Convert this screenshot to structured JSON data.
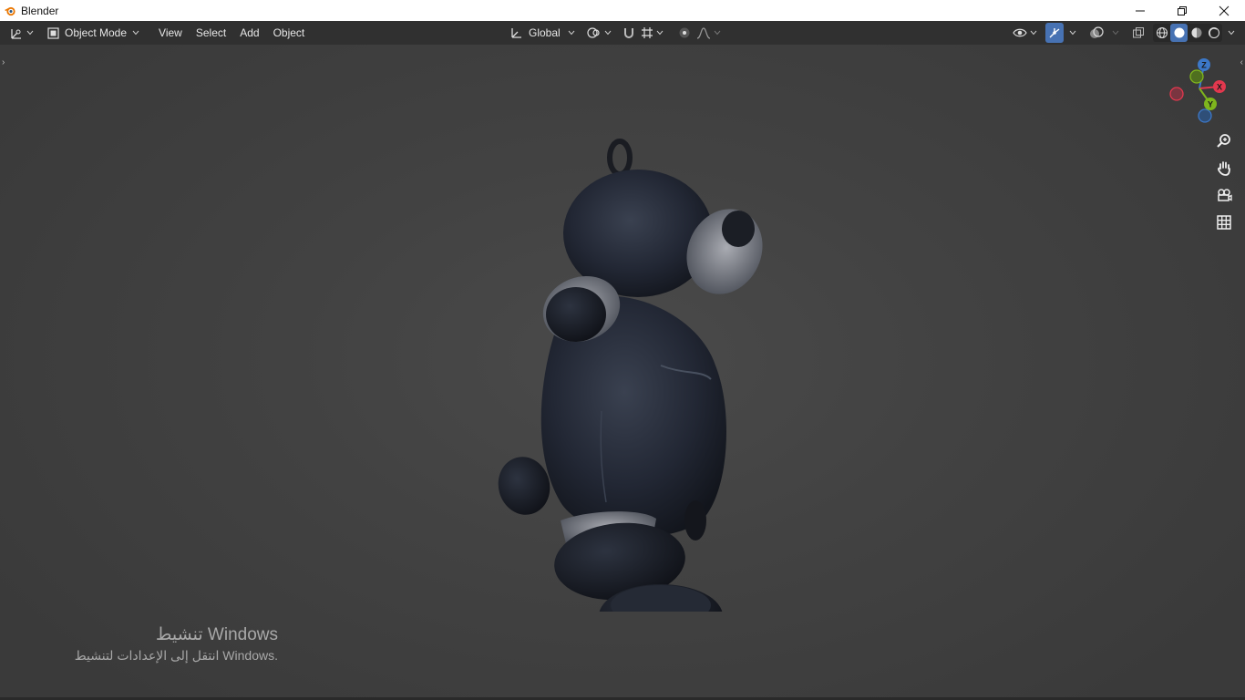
{
  "window": {
    "title": "Blender",
    "app_icon": "blender-logo-icon",
    "controls": [
      "minimize-icon",
      "restore-icon",
      "close-icon"
    ]
  },
  "header": {
    "editor_type_icon": "editor-type-3d-viewport-icon",
    "mode": "Object Mode",
    "menus": [
      "View",
      "Select",
      "Add",
      "Object"
    ],
    "transform_orientation": "Global",
    "pivot_icon": "pivot-point-icon",
    "snap_icon": "snap-magnet-icon",
    "snap_target_icon": "snap-increment-icon",
    "proportional_icon": "proportional-edit-icon",
    "falloff_icon": "falloff-curve-icon",
    "visibility_icon": "object-visibility-icon",
    "gizmo_toggle_icon": "gizmo-toggle-icon",
    "overlay_icon": "overlays-icon",
    "xray_icon": "xray-toggle-icon",
    "shading_modes": [
      "wireframe-shading-icon",
      "solid-shading-icon",
      "material-preview-icon",
      "rendered-shading-icon"
    ],
    "active_shading": "solid",
    "accent_color": "#4772b3"
  },
  "viewport": {
    "navigation_gizmo": {
      "axes": [
        {
          "label": "Z",
          "color": "#3c78c8"
        },
        {
          "label": "X",
          "color": "#e2384e"
        },
        {
          "label": "Y",
          "color": "#7fb51d"
        }
      ]
    },
    "nav_tools": [
      "zoom-icon",
      "hand-pan-icon",
      "camera-view-icon",
      "orthographic-grid-icon"
    ],
    "object": "teddy-bear-mesh"
  },
  "watermark": {
    "line1": "تنشيط Windows",
    "line2": "انتقل إلى الإعدادات لتنشيط Windows."
  }
}
